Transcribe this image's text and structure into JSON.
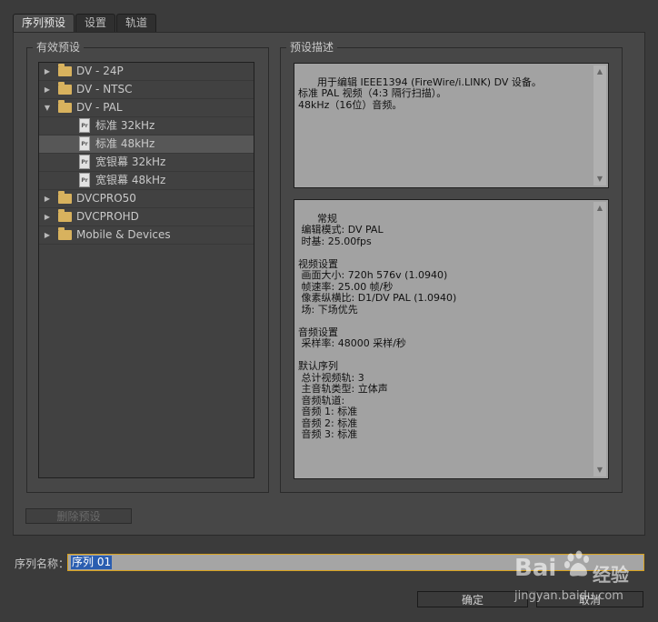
{
  "tabs": [
    {
      "label": "序列预设",
      "active": true
    },
    {
      "label": "设置",
      "active": false
    },
    {
      "label": "轨道",
      "active": false
    }
  ],
  "presets": {
    "title": "有效预设",
    "tree": [
      {
        "type": "folder",
        "label": "DV - 24P",
        "expanded": false
      },
      {
        "type": "folder",
        "label": "DV - NTSC",
        "expanded": false
      },
      {
        "type": "folder",
        "label": "DV - PAL",
        "expanded": true
      },
      {
        "type": "preset",
        "label": "标准 32kHz"
      },
      {
        "type": "preset",
        "label": "标准 48kHz",
        "selected": true
      },
      {
        "type": "preset",
        "label": "宽银幕 32kHz"
      },
      {
        "type": "preset",
        "label": "宽银幕 48kHz"
      },
      {
        "type": "folder",
        "label": "DVCPRO50",
        "expanded": false
      },
      {
        "type": "folder",
        "label": "DVCPROHD",
        "expanded": false
      },
      {
        "type": "folder",
        "label": "Mobile & Devices",
        "expanded": false
      }
    ],
    "delete_button": "删除预设"
  },
  "description": {
    "title": "预设描述",
    "summary": "用于编辑 IEEE1394 (FireWire/i.LINK) DV 设备。\n标准 PAL 视频（4:3 隔行扫描）。\n48kHz（16位）音频。",
    "details": "常规\n 编辑模式: DV PAL\n 时基: 25.00fps\n\n视频设置\n 画面大小: 720h 576v (1.0940)\n 帧速率: 25.00 帧/秒\n 像素纵横比: D1/DV PAL (1.0940)\n 场: 下场优先\n\n音频设置\n 采样率: 48000 采样/秒\n\n默认序列\n 总计视频轨: 3\n 主音轨类型: 立体声\n 音频轨道:\n 音频 1: 标准\n 音频 2: 标准\n 音频 3: 标准"
  },
  "sequence_name": {
    "label": "序列名称：",
    "value": "序列 01"
  },
  "buttons": {
    "ok": "确定",
    "cancel": "取消"
  },
  "watermark": {
    "brand": "Bai",
    "brand2": "经验",
    "url": "jingyan.baidu.com"
  },
  "colors": {
    "background": "#3b3b3b",
    "panel": "#474747",
    "focus": "#d8a21e",
    "selection": "#2a5db0",
    "folder": "#d8b25e"
  }
}
